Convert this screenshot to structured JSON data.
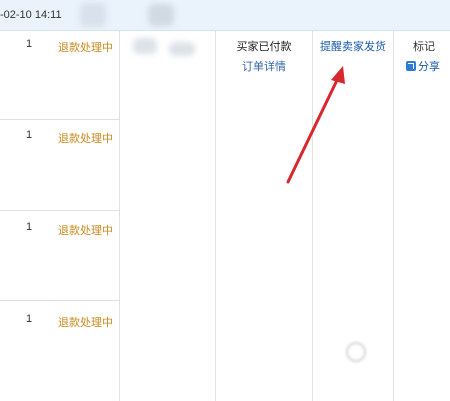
{
  "header": {
    "date": "-02-10 14:11"
  },
  "rows": [
    {
      "quantity": "1",
      "status": "退款处理中"
    },
    {
      "quantity": "1",
      "status": "退款处理中"
    },
    {
      "quantity": "1",
      "status": "退款处理中"
    },
    {
      "quantity": "1",
      "status": "退款处理中"
    }
  ],
  "trade": {
    "status": "买家已付款",
    "detail_link": "订单详情",
    "remind_link": "提醒卖家发货",
    "mark_link": "标记",
    "share_label": "分享"
  },
  "icons": {
    "share": "share-icon",
    "arrow": "arrow-annotation"
  },
  "colors": {
    "header_bg": "#eaf3fc",
    "refund_status": "#c88a1e",
    "link": "#1a5aa6",
    "arrow": "#d9272e"
  }
}
